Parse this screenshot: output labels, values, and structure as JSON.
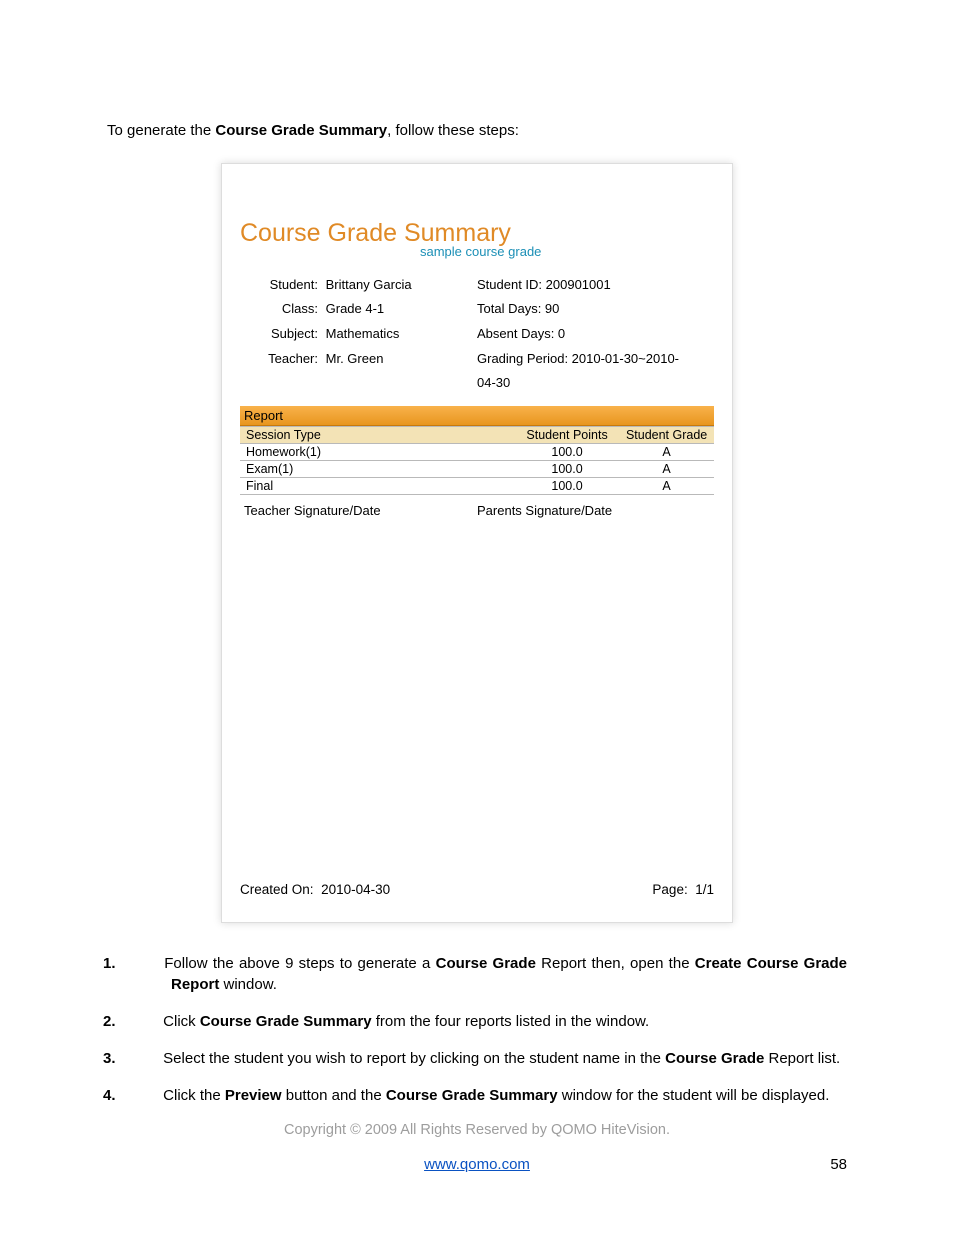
{
  "intro": {
    "prefix": "To generate the ",
    "bold": "Course Grade Summary",
    "suffix": ", follow these steps:"
  },
  "report": {
    "title": "Course Grade Summary",
    "subtitle": "sample course grade",
    "left": [
      {
        "label": "Student:",
        "value": "Brittany Garcia"
      },
      {
        "label": "Class:",
        "value": "Grade 4-1"
      },
      {
        "label": "Subject:",
        "value": "Mathematics"
      },
      {
        "label": "Teacher:",
        "value": "Mr. Green"
      }
    ],
    "right": [
      "Student ID: 200901001",
      "Total Days: 90",
      "Absent Days: 0",
      "Grading Period: 2010-01-30~2010-04-30"
    ],
    "section_band": "Report",
    "columns": [
      "Session Type",
      "Student Points",
      "Student Grade"
    ],
    "rows": [
      {
        "type": "Homework(1)",
        "points": "100.0",
        "grade": "A"
      },
      {
        "type": "Exam(1)",
        "points": "100.0",
        "grade": "A"
      },
      {
        "type": "Final",
        "points": "100.0",
        "grade": "A"
      }
    ],
    "sig_teacher": "Teacher Signature/Date",
    "sig_parent": "Parents Signature/Date",
    "created_on_label": "Created On:",
    "created_on_value": "2010-04-30",
    "page_label": "Page:",
    "page_value": "1/1"
  },
  "steps": [
    [
      {
        "t": "Follow the above 9 steps to generate a "
      },
      {
        "t": "Course Grade",
        "b": true
      },
      {
        "t": " Report then, open the "
      },
      {
        "t": "Create Course Grade Report",
        "b": true
      },
      {
        "t": " window."
      }
    ],
    [
      {
        "t": "Click "
      },
      {
        "t": "Course Grade Summary",
        "b": true
      },
      {
        "t": " from the four reports listed in the window."
      }
    ],
    [
      {
        "t": "Select the student you wish to report by clicking on the student name in the "
      },
      {
        "t": "Course Grade",
        "b": true
      },
      {
        "t": " Report list."
      }
    ],
    [
      {
        "t": "Click the "
      },
      {
        "t": "Preview",
        "b": true
      },
      {
        "t": " button and the "
      },
      {
        "t": "Course Grade Summary",
        "b": true
      },
      {
        "t": " window for the student will be displayed."
      }
    ]
  ],
  "copyright": "Copyright © 2009 All Rights Reserved by QOMO HiteVision.",
  "footer_link": "www.qomo.com",
  "page_number": "58"
}
